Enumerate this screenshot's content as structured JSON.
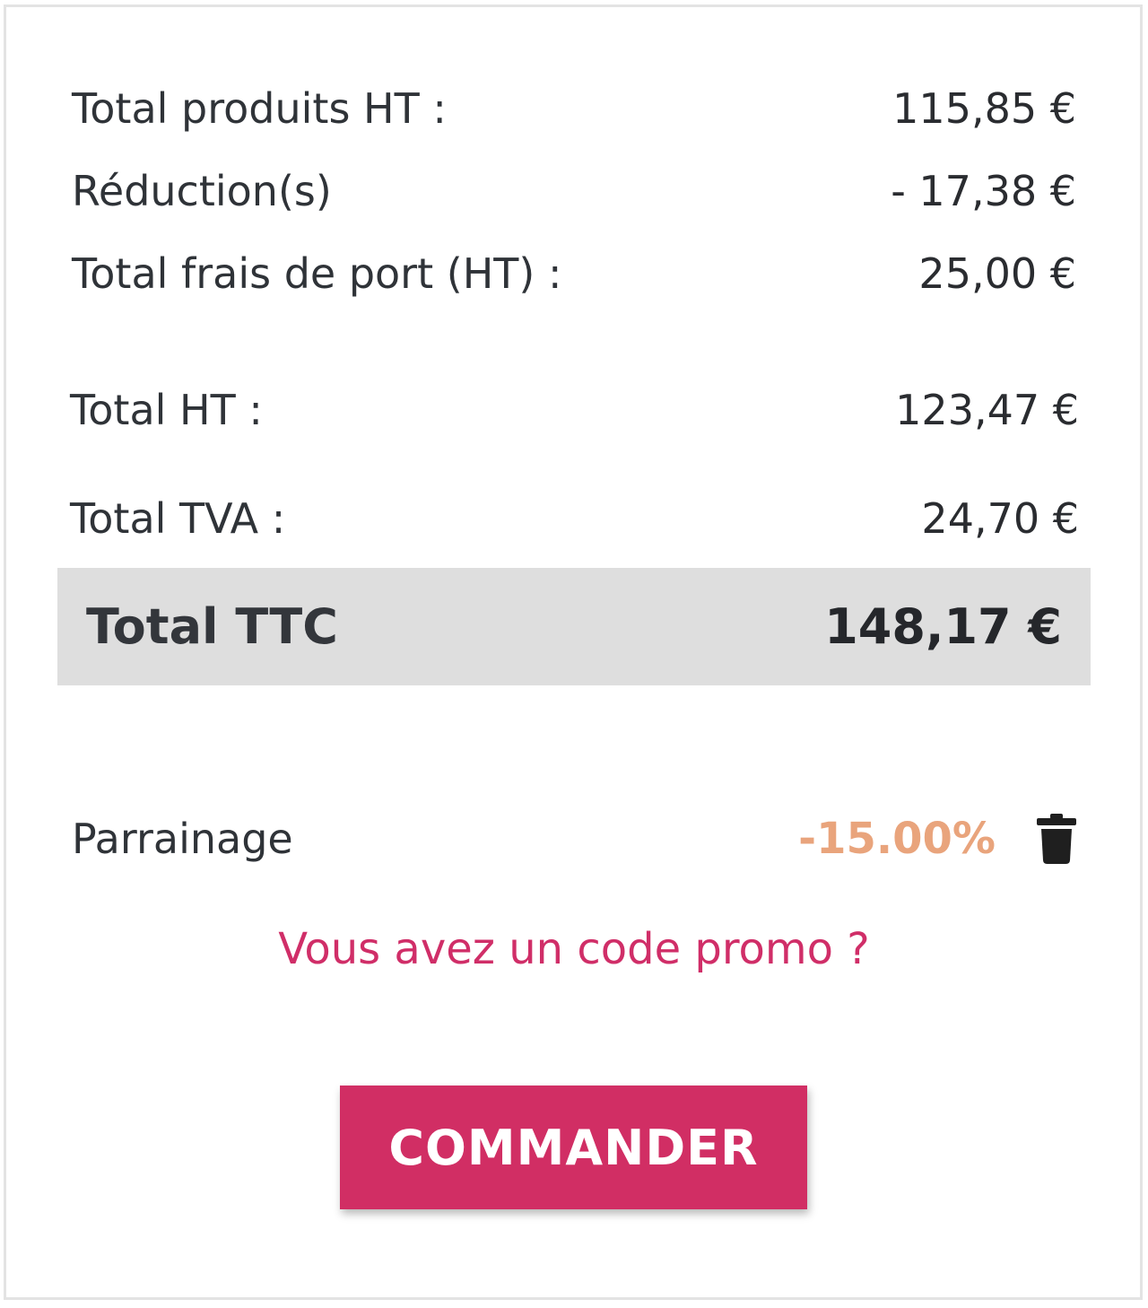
{
  "summary": {
    "rows": [
      {
        "label": "Total produits HT :",
        "value": "115,85 €"
      },
      {
        "label": "Réduction(s)",
        "value": "- 17,38 €"
      },
      {
        "label": "Total frais de port (HT) :",
        "value": "25,00 €"
      },
      {
        "label": "Total HT :",
        "value": "123,47 €"
      },
      {
        "label": "Total TVA :",
        "value": "24,70 €"
      }
    ],
    "total_ttc": {
      "label": "Total TTC",
      "value": "148,17 €"
    }
  },
  "referral": {
    "label": "Parrainage",
    "discount": "-15.00%",
    "delete_icon": "trash-icon"
  },
  "promo": {
    "link_text": "Vous avez un code promo ?"
  },
  "actions": {
    "order_label": "COMMANDER"
  },
  "colors": {
    "accent": "#d12e64",
    "discount": "#e9a47c",
    "total_background": "#dedede"
  }
}
